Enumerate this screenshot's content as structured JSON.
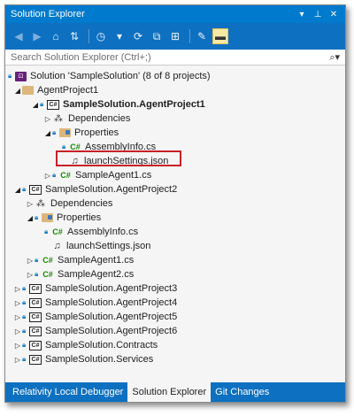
{
  "window": {
    "title": "Solution Explorer",
    "title_buttons": [
      "▾",
      "⊥",
      "✕"
    ]
  },
  "search": {
    "placeholder": "Search Solution Explorer (Ctrl+;)"
  },
  "tree": {
    "solution": "Solution 'SampleSolution' (8 of 8 projects)",
    "agentproject1_folder": "AgentProject1",
    "project1": "SampleSolution.AgentProject1",
    "p1_dependencies": "Dependencies",
    "p1_properties": "Properties",
    "p1_assemblyinfo": "AssemblyInfo.cs",
    "p1_launchsettings": "launchSettings.json",
    "p1_sampleagent1": "SampleAgent1.cs",
    "project2": "SampleSolution.AgentProject2",
    "p2_dependencies": "Dependencies",
    "p2_properties": "Properties",
    "p2_assemblyinfo": "AssemblyInfo.cs",
    "p2_launchsettings": "launchSettings.json",
    "p2_sampleagent1": "SampleAgent1.cs",
    "p2_sampleagent2": "SampleAgent2.cs",
    "project3": "SampleSolution.AgentProject3",
    "project4": "SampleSolution.AgentProject4",
    "project5": "SampleSolution.AgentProject5",
    "project6": "SampleSolution.AgentProject6",
    "contracts": "SampleSolution.Contracts",
    "services": "SampleSolution.Services"
  },
  "icons": {
    "cs_text": "C#",
    "csproj_text": "C#"
  },
  "tabs": [
    {
      "label": "Relativity Local Debugger",
      "active": false
    },
    {
      "label": "Solution Explorer",
      "active": true
    },
    {
      "label": "Git Changes",
      "active": false
    }
  ],
  "colors": {
    "accent": "#007acc",
    "toolbar": "#0e70c0",
    "highlight_border": "#c8202a"
  }
}
